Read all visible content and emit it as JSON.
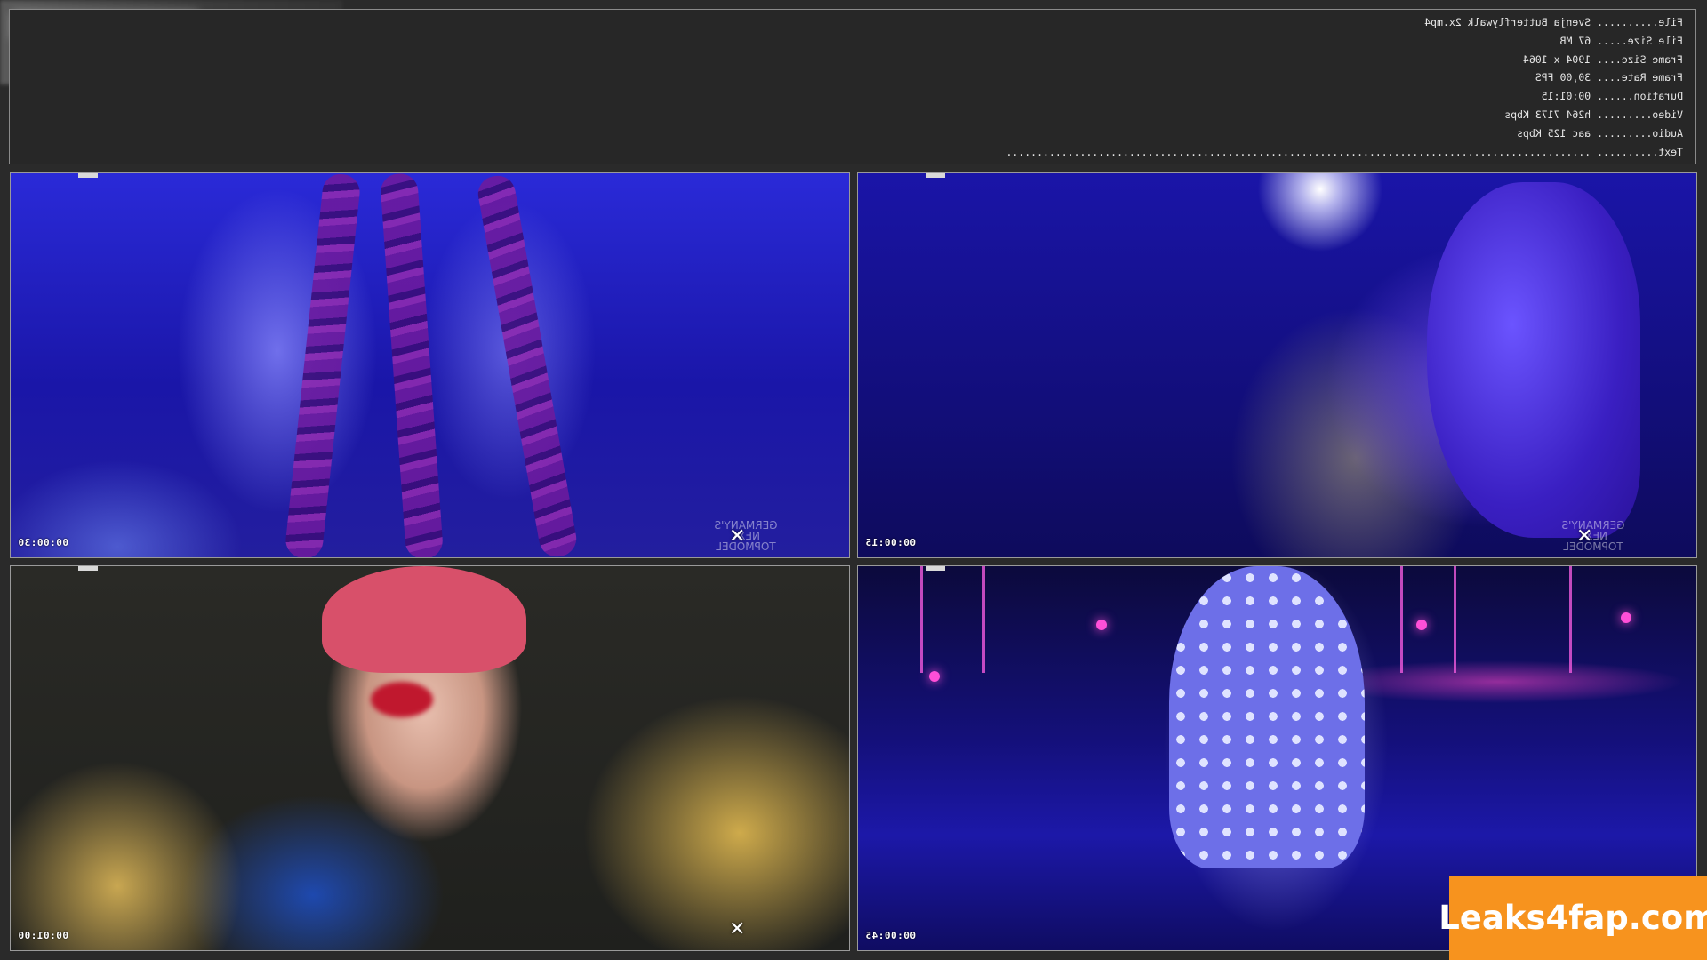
{
  "info": {
    "file": "File.......... Svenja Butterflywalk 2x.mp4",
    "file_size": "File Size..... 67 MB",
    "frame_size": "Frame Size.... 1904 x 1064",
    "frame_rate": "Frame Rate.... 30,00 FPS",
    "duration": "Duration...... 00:01:15",
    "video": "Video......... h264 7173 Kbps",
    "audio": "Audio......... aac 125 Kbps",
    "text": "Text.......... ..............................................................................................."
  },
  "thumbnails": [
    {
      "timestamp": "00:00:30",
      "close": "✕",
      "overlay": "GERMANY'S NEXT TOPMODEL"
    },
    {
      "timestamp": "00:00:15",
      "close": "✕",
      "overlay": "GERMANY'S NEXT TOPMODEL"
    },
    {
      "timestamp": "00:01:00",
      "close": "✕"
    },
    {
      "timestamp": "00:00:45"
    }
  ],
  "watermark": "Leaks4fap.com",
  "colors": {
    "watermark_bg": "#f7931e",
    "panel_bg": "#272727",
    "border": "#8a8a8a"
  }
}
